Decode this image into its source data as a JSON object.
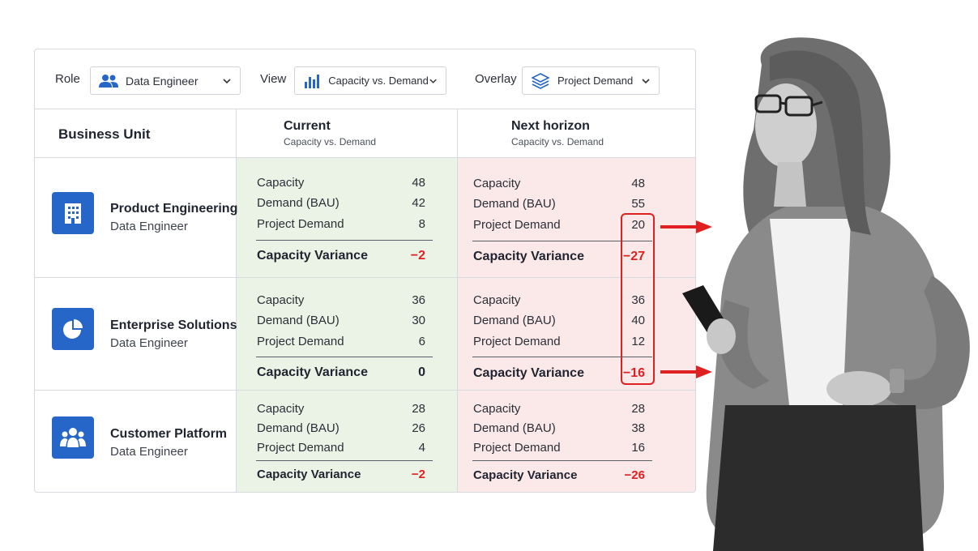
{
  "toolbar": {
    "role_label": "Role",
    "role_value": "Data Engineer",
    "view_label": "View",
    "view_value": "Capacity vs. Demand",
    "overlay_label": "Overlay",
    "overlay_value": "Project Demand"
  },
  "header": {
    "business_unit": "Business Unit",
    "current_title": "Current",
    "current_sub": "Capacity vs. Demand",
    "next_title": "Next horizon",
    "next_sub": "Capacity vs. Demand"
  },
  "colors": {
    "accent": "#2566c8",
    "negative": "#e02020",
    "current_bg": "#ebf3e6",
    "next_bg": "#fbe8e8"
  },
  "units": [
    {
      "name": "Product Engineering",
      "role": "Data Engineer",
      "icon": "building-icon",
      "current": {
        "capacity_label": "Capacity",
        "capacity": "48",
        "demand_label": "Demand (BAU)",
        "demand": "42",
        "project_label": "Project Demand",
        "project": "8",
        "variance_label": "Capacity Variance",
        "variance": "−2"
      },
      "next": {
        "capacity_label": "Capacity",
        "capacity": "48",
        "demand_label": "Demand (BAU)",
        "demand": "55",
        "project_label": "Project Demand",
        "project": "20",
        "variance_label": "Capacity Variance",
        "variance": "−27"
      }
    },
    {
      "name": "Enterprise Solutions",
      "role": "Data Engineer",
      "icon": "pie-chart-icon",
      "current": {
        "capacity_label": "Capacity",
        "capacity": "36",
        "demand_label": "Demand (BAU)",
        "demand": "30",
        "project_label": "Project Demand",
        "project": "6",
        "variance_label": "Capacity Variance",
        "variance": "0"
      },
      "next": {
        "capacity_label": "Capacity",
        "capacity": "36",
        "demand_label": "Demand (BAU)",
        "demand": "40",
        "project_label": "Project Demand",
        "project": "12",
        "variance_label": "Capacity Variance",
        "variance": "−16"
      }
    },
    {
      "name": "Customer Platform",
      "role": "Data Engineer",
      "icon": "people-icon",
      "current": {
        "capacity_label": "Capacity",
        "capacity": "28",
        "demand_label": "Demand (BAU)",
        "demand": "26",
        "project_label": "Project Demand",
        "project": "4",
        "variance_label": "Capacity Variance",
        "variance": "−2"
      },
      "next": {
        "capacity_label": "Capacity",
        "capacity": "28",
        "demand_label": "Demand (BAU)",
        "demand": "38",
        "project_label": "Project Demand",
        "project": "16",
        "variance_label": "Capacity Variance",
        "variance": "−26"
      }
    }
  ]
}
